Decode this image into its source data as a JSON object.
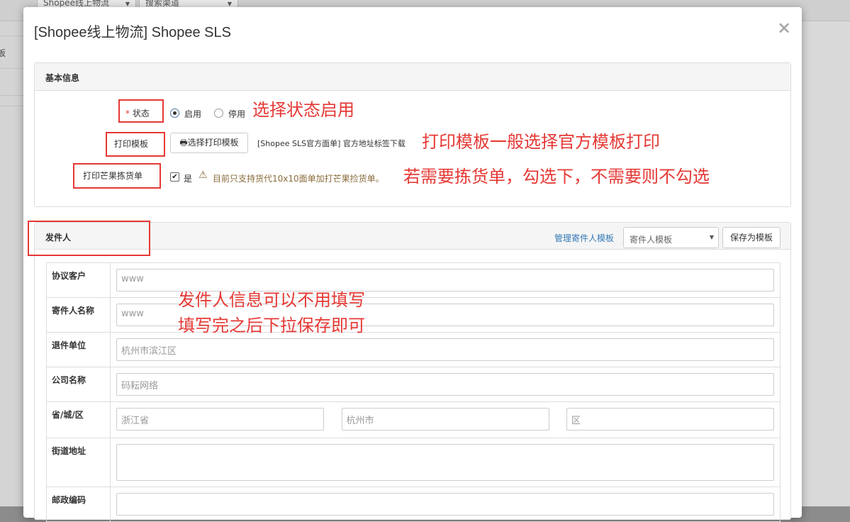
{
  "background": {
    "select1": "Shopee线上物流",
    "select2": "搜索渠道",
    "left_text": "板"
  },
  "modal": {
    "title": "[Shopee线上物流] Shopee SLS",
    "close": "×"
  },
  "basic": {
    "title": "基本信息",
    "status_label": "状态",
    "status_required": "*",
    "status_options": [
      "启用",
      "停用"
    ],
    "status_selected": "启用",
    "print_template_label": "打印模板",
    "print_template_button": "选择打印模板",
    "print_template_value": "[Shopee SLS官方面单] 官方地址标签下载",
    "mango_label": "打印芒果拣货单",
    "mango_check_label": "是",
    "mango_checked": true,
    "mango_warning": "目前只支持货代10x10面单加打芒果捡货单。"
  },
  "annotations": {
    "note_status": "选择状态启用",
    "note_print": "打印模板一般选择官方模板打印",
    "note_mango": "若需要拣货单，勾选下，不需要则不勾选",
    "note_sender_1": "发件人信息可以不用填写",
    "note_sender_2": "填写完之后下拉保存即可"
  },
  "sender": {
    "title": "发件人",
    "manage_link": "管理寄件人模板",
    "template_placeholder": "寄件人模板",
    "save_template_button": "保存为模板",
    "fields": {
      "agreement_customer": {
        "label": "协议客户",
        "value": "www"
      },
      "sender_name": {
        "label": "寄件人名称",
        "value": "www"
      },
      "return_unit": {
        "label": "退件单位",
        "value": "杭州市滨江区"
      },
      "company": {
        "label": "公司名称",
        "value": "码耘网络"
      },
      "region": {
        "label": "省/城/区",
        "province": "浙江省",
        "city": "杭州市",
        "district": "区"
      },
      "street": {
        "label": "街道地址",
        "value": ""
      },
      "postcode": {
        "label": "邮政编码",
        "value": ""
      }
    }
  },
  "colors": {
    "annotation_red": "#e53935",
    "link_blue": "#337ab7",
    "warning_text": "#8a6d3b",
    "warning_icon": "#8a6d3b"
  }
}
